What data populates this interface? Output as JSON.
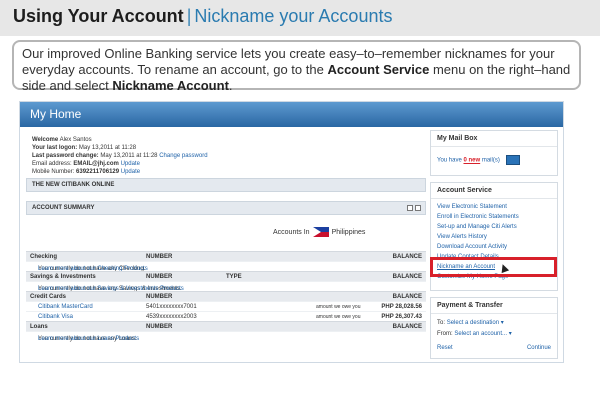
{
  "header": {
    "title": "Using Your Account",
    "separator": "|",
    "subtitle": "Nickname your Accounts"
  },
  "callout": {
    "text_prefix": "Our improved Online Banking service lets you create easy–to–remember nicknames for your everyday accounts. To rename an account, go to the ",
    "account_service": "Account Service",
    "text_mid": " menu on the right–hand side and select ",
    "nickname_account": "Nickname Account",
    "text_end": "."
  },
  "panel": {
    "title": "My Home",
    "welcome": {
      "welcome_label": "Welcome",
      "welcome_name": "Alex Santos",
      "last_logon_label": "Your last logon:",
      "last_logon_value": "May 13,2011 at 11:28",
      "last_pw_label": "Last password change:",
      "last_pw_value": "May 13,2011 at 11:28",
      "change_password": "Change password",
      "email_label": "Email address:",
      "email_value": "EMAIL@jhj.com",
      "update": "Update",
      "mobile_label": "Mobile Number:",
      "mobile_value": "6392211706129"
    },
    "new_citibank": "THE NEW CITIBANK ONLINE",
    "account_summary": "ACCOUNT SUMMARY",
    "accounts_in": "Accounts In",
    "country": "Philippines",
    "columns": {
      "number": "NUMBER",
      "type": "TYPE",
      "balance": "BALANCE"
    },
    "checking": {
      "title": "Checking",
      "empty_text": "You currently do not have any Checking.",
      "learn_more": "Learn more about our Checking Products"
    },
    "savings": {
      "title": "Savings & Investments",
      "empty_text": "You currently do not have any Savings & Investments.",
      "learn_more": "Learn more about our Savings & Investments Products"
    },
    "credit": {
      "title": "Credit Cards",
      "rows": [
        {
          "name": "Citibank MasterCard",
          "number": "5401xxxxxxxx7001",
          "owed_label": "amount we owe you",
          "amount": "PHP 28,028.56"
        },
        {
          "name": "Citibank Visa",
          "number": "4539xxxxxxxx2003",
          "owed_label": "amount we owe you",
          "amount": "PHP 26,307.43"
        }
      ]
    },
    "loans": {
      "title": "Loans",
      "empty_text": "You currently do not have any Loans.",
      "learn_more": "Learn more about our Loans Products"
    },
    "mailbox": {
      "title": "My Mail Box",
      "you_have": "You have",
      "count_new": "0 new",
      "mails": "mail(s)"
    },
    "account_service": {
      "title": "Account Service",
      "items": [
        "View Electronic Statement",
        "Enroll in Electronic Statements",
        "Set-up and Manage Citi Alerts",
        "View Alerts History",
        "Download Account Activity",
        "Update Contact Details",
        "Nickname an Account",
        "Customize My Home Page"
      ]
    },
    "payment": {
      "title": "Payment & Transfer",
      "to_label": "To:",
      "to_value": "Select a destination",
      "from_label": "From:",
      "from_value": "Select an account...",
      "reset": "Reset",
      "continue": "Continue"
    }
  },
  "colors": {
    "accent": "#2a7bb0",
    "highlight": "#d8202a"
  }
}
